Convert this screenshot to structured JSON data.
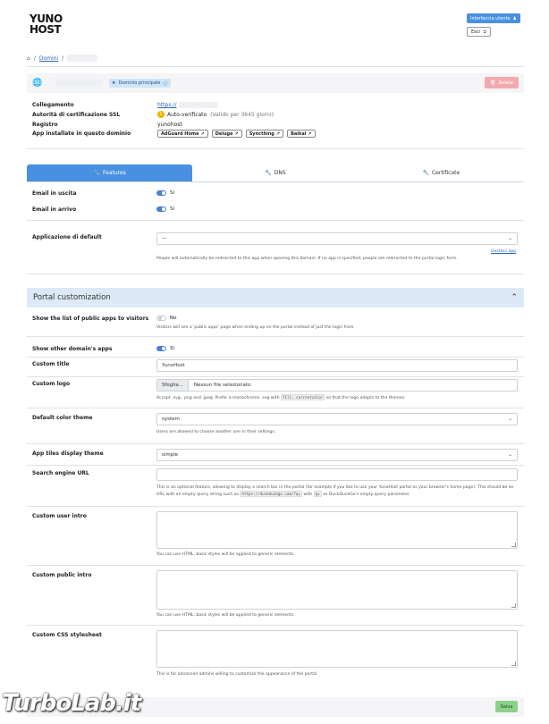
{
  "header": {
    "logo_line1": "YUNO",
    "logo_line2": "HOST",
    "user_button": "Interfaccia utente",
    "logout_button": "Esci"
  },
  "breadcrumb": {
    "home_icon": "home-icon",
    "sep1": "/",
    "domains": "Domini",
    "sep2": "/"
  },
  "domain": {
    "main_badge": "Dominio principale",
    "delete_button": "Delete"
  },
  "info": {
    "link_label": "Collegamento",
    "link_value": "https://",
    "ssl_label": "Autorità di certificazione SSL",
    "ssl_value": "Auto-verificato",
    "ssl_note": "(Valido per 3645 giorni)",
    "registry_label": "Registro",
    "registry_value": "yunohost",
    "apps_label": "App installate in questo dominio",
    "apps": [
      "AdGuard Home",
      "Deluge",
      "Syncthing",
      "Baikal"
    ]
  },
  "tabs": [
    {
      "label": "Features",
      "active": true
    },
    {
      "label": "DNS",
      "active": false
    },
    {
      "label": "Certificate",
      "active": false
    }
  ],
  "features": {
    "email_out_label": "Email in uscita",
    "email_out_value": "Sì",
    "email_in_label": "Email in arrivo",
    "email_in_value": "Sì",
    "default_app_label": "Applicazione di default",
    "default_app_value": "---",
    "manage_link": "Gestisci app",
    "default_app_help": "People will automatically be redirected to this app when opening this domain. If no app is specified, people are redirected to the portal login form."
  },
  "portal": {
    "section_title": "Portal customization",
    "public_apps_label": "Show the list of public apps to visitors",
    "public_apps_value": "No",
    "public_apps_help": "Visitors will see a 'public apps' page when ending up on the portal instead of just the login from.",
    "other_domains_label": "Show other domain's apps",
    "other_domains_value": "Sì",
    "custom_title_label": "Custom title",
    "custom_title_value": "YunoHost",
    "custom_logo_label": "Custom logo",
    "file_button": "Sfoglia...",
    "file_value": "Nessun file selezionato.",
    "logo_help_1": "Accept .svg, .png and .jpeg. Prefer a monochrome .svg with",
    "logo_help_code": "fill: currentcolor",
    "logo_help_2": "so that the logo adapts to the themes.",
    "color_theme_label": "Default color theme",
    "color_theme_value": "system",
    "color_theme_help": "Users are allowed to choose another one in their settings.",
    "tiles_label": "App tiles display theme",
    "tiles_value": "simple",
    "search_label": "Search engine URL",
    "search_value": "",
    "search_help_1": "This is an optional feature, allowing to display a search bar in the portal (for example if you like to use your YunoHost portal as your browser's home page). This should be an URL with an empty query string such as",
    "search_help_code1": "https://duckduckgo.com/?q=",
    "search_help_2": "with",
    "search_help_code2": "q=",
    "search_help_3": "as DuckDuckGo's empty query parameter",
    "user_intro_label": "Custom user intro",
    "user_intro_help": "You can use HTML, basic styles will be applied to generic elements.",
    "public_intro_label": "Custom public intro",
    "public_intro_help": "You can use HTML, basic styles will be applied to generic elements.",
    "css_label": "Custom CSS stylesheet",
    "css_help": "This is for advanced admins willing to customize the appearance of the portal",
    "save_button": "Salva"
  },
  "watermark": "TurboLab.it",
  "colors": {
    "accent": "#4a90e2",
    "section_bg": "#dde9f7",
    "delete": "#f2aab0",
    "save": "#8bd18a"
  }
}
